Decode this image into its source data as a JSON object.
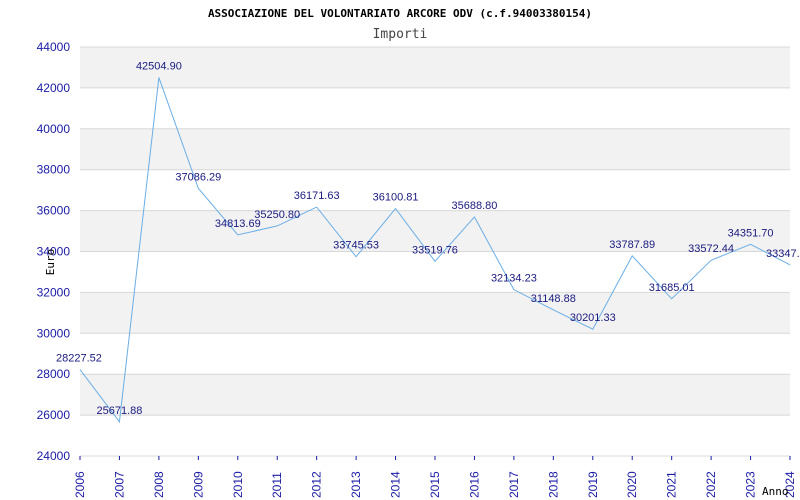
{
  "chart_data": {
    "type": "line",
    "title": "ASSOCIAZIONE DEL VOLONTARIATO ARCORE ODV (c.f.94003380154)",
    "subtitle": "Importi",
    "xlabel": "Anno",
    "ylabel": "Euro",
    "ylim": [
      24000,
      44000
    ],
    "yticks": [
      "24000",
      "26000",
      "28000",
      "30000",
      "32000",
      "34000",
      "36000",
      "38000",
      "40000",
      "42000",
      "44000"
    ],
    "categories": [
      "2006",
      "2007",
      "2008",
      "2009",
      "2010",
      "2011",
      "2012",
      "2013",
      "2014",
      "2015",
      "2016",
      "2017",
      "2018",
      "2019",
      "2020",
      "2021",
      "2022",
      "2023",
      "2024"
    ],
    "series": [
      {
        "values": [
          28227.52,
          25671.88,
          42504.9,
          37086.29,
          34813.69,
          35250.8,
          36171.63,
          33745.53,
          36100.81,
          33519.76,
          35688.8,
          32134.23,
          31148.88,
          30201.33,
          33787.89,
          31685.01,
          33572.44,
          34351.7,
          33347.0
        ],
        "labels": [
          "28227.52",
          "25671.88",
          "42504.90",
          "37086.29",
          "34813.69",
          "35250.80",
          "36171.63",
          "33745.53",
          "36100.81",
          "33519.76",
          "35688.80",
          "32134.23",
          "31148.88",
          "30201.33",
          "33787.89",
          "31685.01",
          "33572.44",
          "34351.70",
          "33347."
        ],
        "color": "#6aaee6"
      }
    ],
    "grid": true,
    "band_color": "#f2f2f2",
    "tick_color": "#1a1aa6"
  }
}
